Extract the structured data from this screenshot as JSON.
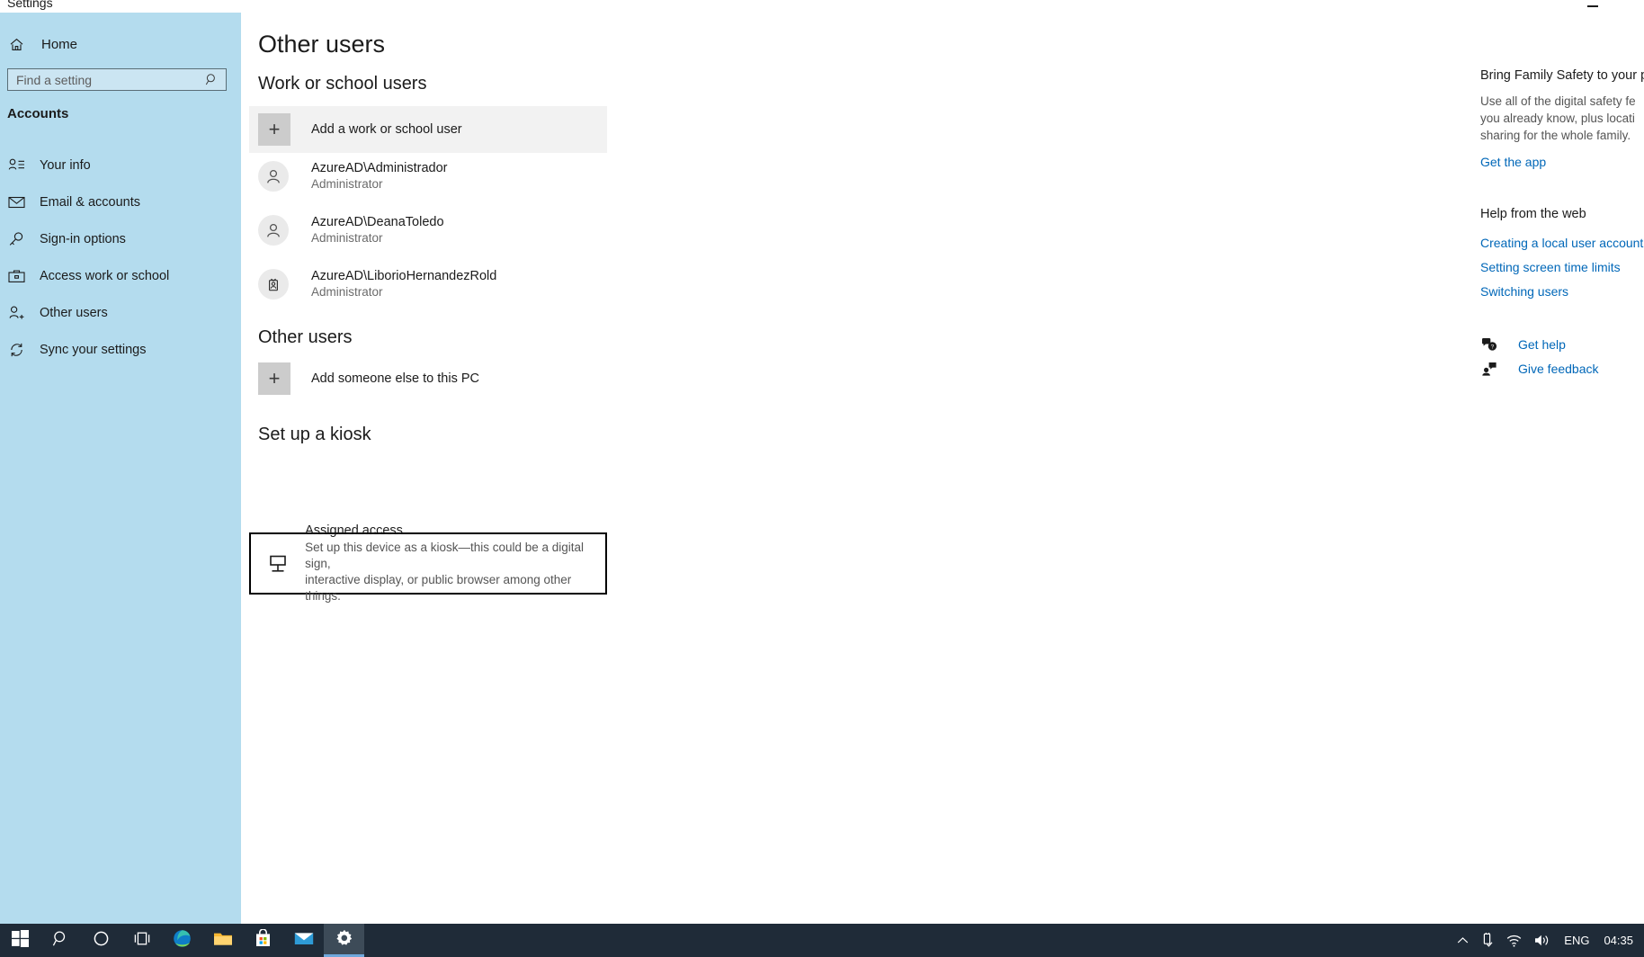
{
  "window": {
    "title": "Settings",
    "minimize_label": "Minimize"
  },
  "sidebar": {
    "home_label": "Home",
    "search": {
      "placeholder": "Find a setting",
      "value": "",
      "icon": "search-icon"
    },
    "category": "Accounts",
    "items": [
      {
        "label": "Your info",
        "icon": "user-info-icon",
        "selected": false
      },
      {
        "label": "Email & accounts",
        "icon": "envelope-icon",
        "selected": false
      },
      {
        "label": "Sign-in options",
        "icon": "key-icon",
        "selected": false
      },
      {
        "label": "Access work or school",
        "icon": "briefcase-icon",
        "selected": false
      },
      {
        "label": "Other users",
        "icon": "add-user-icon",
        "selected": true
      },
      {
        "label": "Sync your settings",
        "icon": "sync-icon",
        "selected": false
      }
    ]
  },
  "main": {
    "page_title": "Other users",
    "work_section": {
      "heading": "Work or school users",
      "add_button": {
        "label": "Add a work or school user",
        "icon": "plus-icon",
        "hovered": true
      },
      "users": [
        {
          "name": "AzureAD\\Administrador",
          "role": "Administrator",
          "icon": "person-avatar-icon"
        },
        {
          "name": "AzureAD\\DeanaToledo",
          "role": "Administrator",
          "icon": "person-avatar-icon"
        },
        {
          "name": "AzureAD\\LiborioHernandezRold",
          "role": "Administrator",
          "icon": "badge-avatar-icon"
        }
      ]
    },
    "other_section": {
      "heading": "Other users",
      "add_button": {
        "label": "Add someone else to this PC",
        "icon": "plus-icon"
      }
    },
    "kiosk_section": {
      "heading": "Set up a kiosk",
      "card": {
        "title": "Assigned access",
        "description_line1": "Set up this device as a kiosk—this could be a digital sign,",
        "description_line2": "interactive display, or public browser among other things.",
        "icon": "kiosk-display-icon",
        "focused": true
      }
    }
  },
  "right_panel": {
    "promo": {
      "heading": "Bring Family Safety to your ph",
      "body_line1": "Use all of the digital safety fe",
      "body_line2": "you already know, plus locati",
      "body_line3": "sharing for the whole family.",
      "link": "Get the app"
    },
    "help": {
      "heading": "Help from the web",
      "links": [
        "Creating a local user account",
        "Setting screen time limits",
        "Switching users"
      ]
    },
    "actions": [
      {
        "label": "Get help",
        "icon": "question-bubble-icon"
      },
      {
        "label": "Give feedback",
        "icon": "feedback-person-icon"
      }
    ]
  },
  "taskbar": {
    "items": [
      {
        "name": "start-button",
        "icon": "windows-logo-icon",
        "active": false
      },
      {
        "name": "search-button",
        "icon": "magnifier-icon",
        "active": false
      },
      {
        "name": "cortana-button",
        "icon": "circle-icon",
        "active": false
      },
      {
        "name": "task-view-button",
        "icon": "task-view-icon",
        "active": false
      },
      {
        "name": "edge-button",
        "icon": "edge-browser-icon",
        "active": false
      },
      {
        "name": "file-explorer-button",
        "icon": "folder-icon",
        "active": false
      },
      {
        "name": "microsoft-store-button",
        "icon": "store-bag-icon",
        "active": false
      },
      {
        "name": "mail-button",
        "icon": "mail-envelope-icon",
        "active": false
      },
      {
        "name": "settings-button",
        "icon": "gear-icon",
        "active": true
      }
    ],
    "tray": {
      "chevron": "show-hidden-icons",
      "usb": "usb-eject-icon",
      "network": "wifi-icon",
      "volume": "speaker-icon",
      "language": "ENG",
      "clock": "04:35"
    }
  },
  "colors": {
    "sidebar_bg": "#b4dcee",
    "link": "#0067b8",
    "taskbar_bg": "#1f2b38",
    "hover_row": "#f2f2f2",
    "tile_gray": "#cccccc"
  }
}
